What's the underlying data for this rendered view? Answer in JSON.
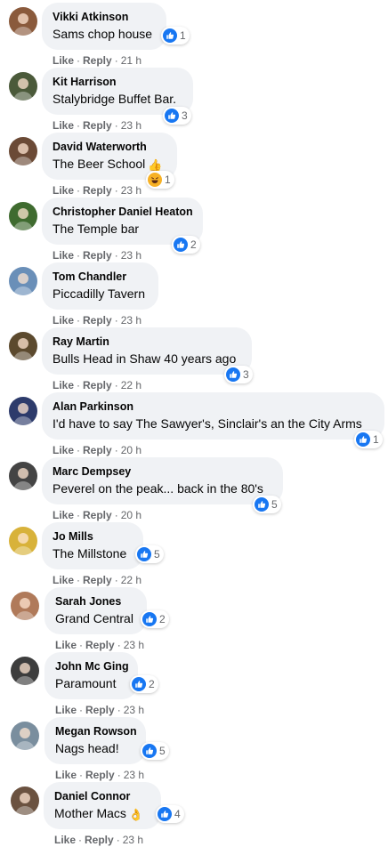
{
  "comments": [
    {
      "author": "Vikki Atkinson",
      "text": "Sams chop house",
      "emoji": "",
      "reaction_type": "like",
      "reactions": "1",
      "time": "21 h",
      "avatar_color": "#8a5a3c"
    },
    {
      "author": "Kit Harrison",
      "text": "Stalybridge Buffet Bar.",
      "emoji": "",
      "reaction_type": "like",
      "reactions": "3",
      "time": "23 h",
      "avatar_color": "#4b5a3a"
    },
    {
      "author": "David Waterworth",
      "text": "The Beer School",
      "emoji": "👍",
      "reaction_type": "haha",
      "reactions": "1",
      "time": "23 h",
      "avatar_color": "#6b4a36"
    },
    {
      "author": "Christopher Daniel Heaton",
      "text": "The Temple bar",
      "emoji": "",
      "reaction_type": "like",
      "reactions": "2",
      "time": "23 h",
      "avatar_color": "#3f6b2f"
    },
    {
      "author": "Tom Chandler",
      "text": "Piccadilly Tavern",
      "emoji": "",
      "reaction_type": "none",
      "reactions": "",
      "time": "23 h",
      "avatar_color": "#6a8fb8"
    },
    {
      "author": "Ray Martin",
      "text": "Bulls Head in Shaw 40 years ago",
      "emoji": "",
      "reaction_type": "like",
      "reactions": "3",
      "time": "22 h",
      "avatar_color": "#5c4a2e"
    },
    {
      "author": "Alan Parkinson",
      "text": "I'd have to say The Sawyer's, Sinclair's an the City Arms",
      "emoji": "",
      "reaction_type": "like",
      "reactions": "1",
      "time": "20 h",
      "avatar_color": "#2d3b6b"
    },
    {
      "author": "Marc Dempsey",
      "text": "Peverel on the peak... back in the 80's",
      "emoji": "",
      "reaction_type": "like",
      "reactions": "5",
      "time": "20 h",
      "avatar_color": "#444444"
    },
    {
      "author": "Jo Mills",
      "text": "The Millstone",
      "emoji": "",
      "reaction_type": "like",
      "reactions": "5",
      "time": "22 h",
      "avatar_color": "#d8b23a"
    },
    {
      "author": "Sarah Jones",
      "text": "Grand Central",
      "emoji": "",
      "reaction_type": "like",
      "reactions": "2",
      "time": "23 h",
      "avatar_color": "#b07a5a"
    },
    {
      "author": "John Mc Ging",
      "text": "Paramount",
      "emoji": "",
      "reaction_type": "like",
      "reactions": "2",
      "time": "23 h",
      "avatar_color": "#3d3d3d"
    },
    {
      "author": "Megan Rowson",
      "text": "Nags head!",
      "emoji": "",
      "reaction_type": "like",
      "reactions": "5",
      "time": "23 h",
      "avatar_color": "#7a8e9e"
    },
    {
      "author": "Daniel Connor",
      "text": "Mother Macs",
      "emoji": "👌",
      "reaction_type": "like",
      "reactions": "4",
      "time": "23 h",
      "avatar_color": "#6b5240"
    }
  ],
  "labels": {
    "like": "Like",
    "reply": "Reply",
    "separator": "·"
  },
  "colors": {
    "bubble": "#f0f2f5",
    "like_blue": "#1877f2",
    "meta_gray": "#65676b"
  }
}
